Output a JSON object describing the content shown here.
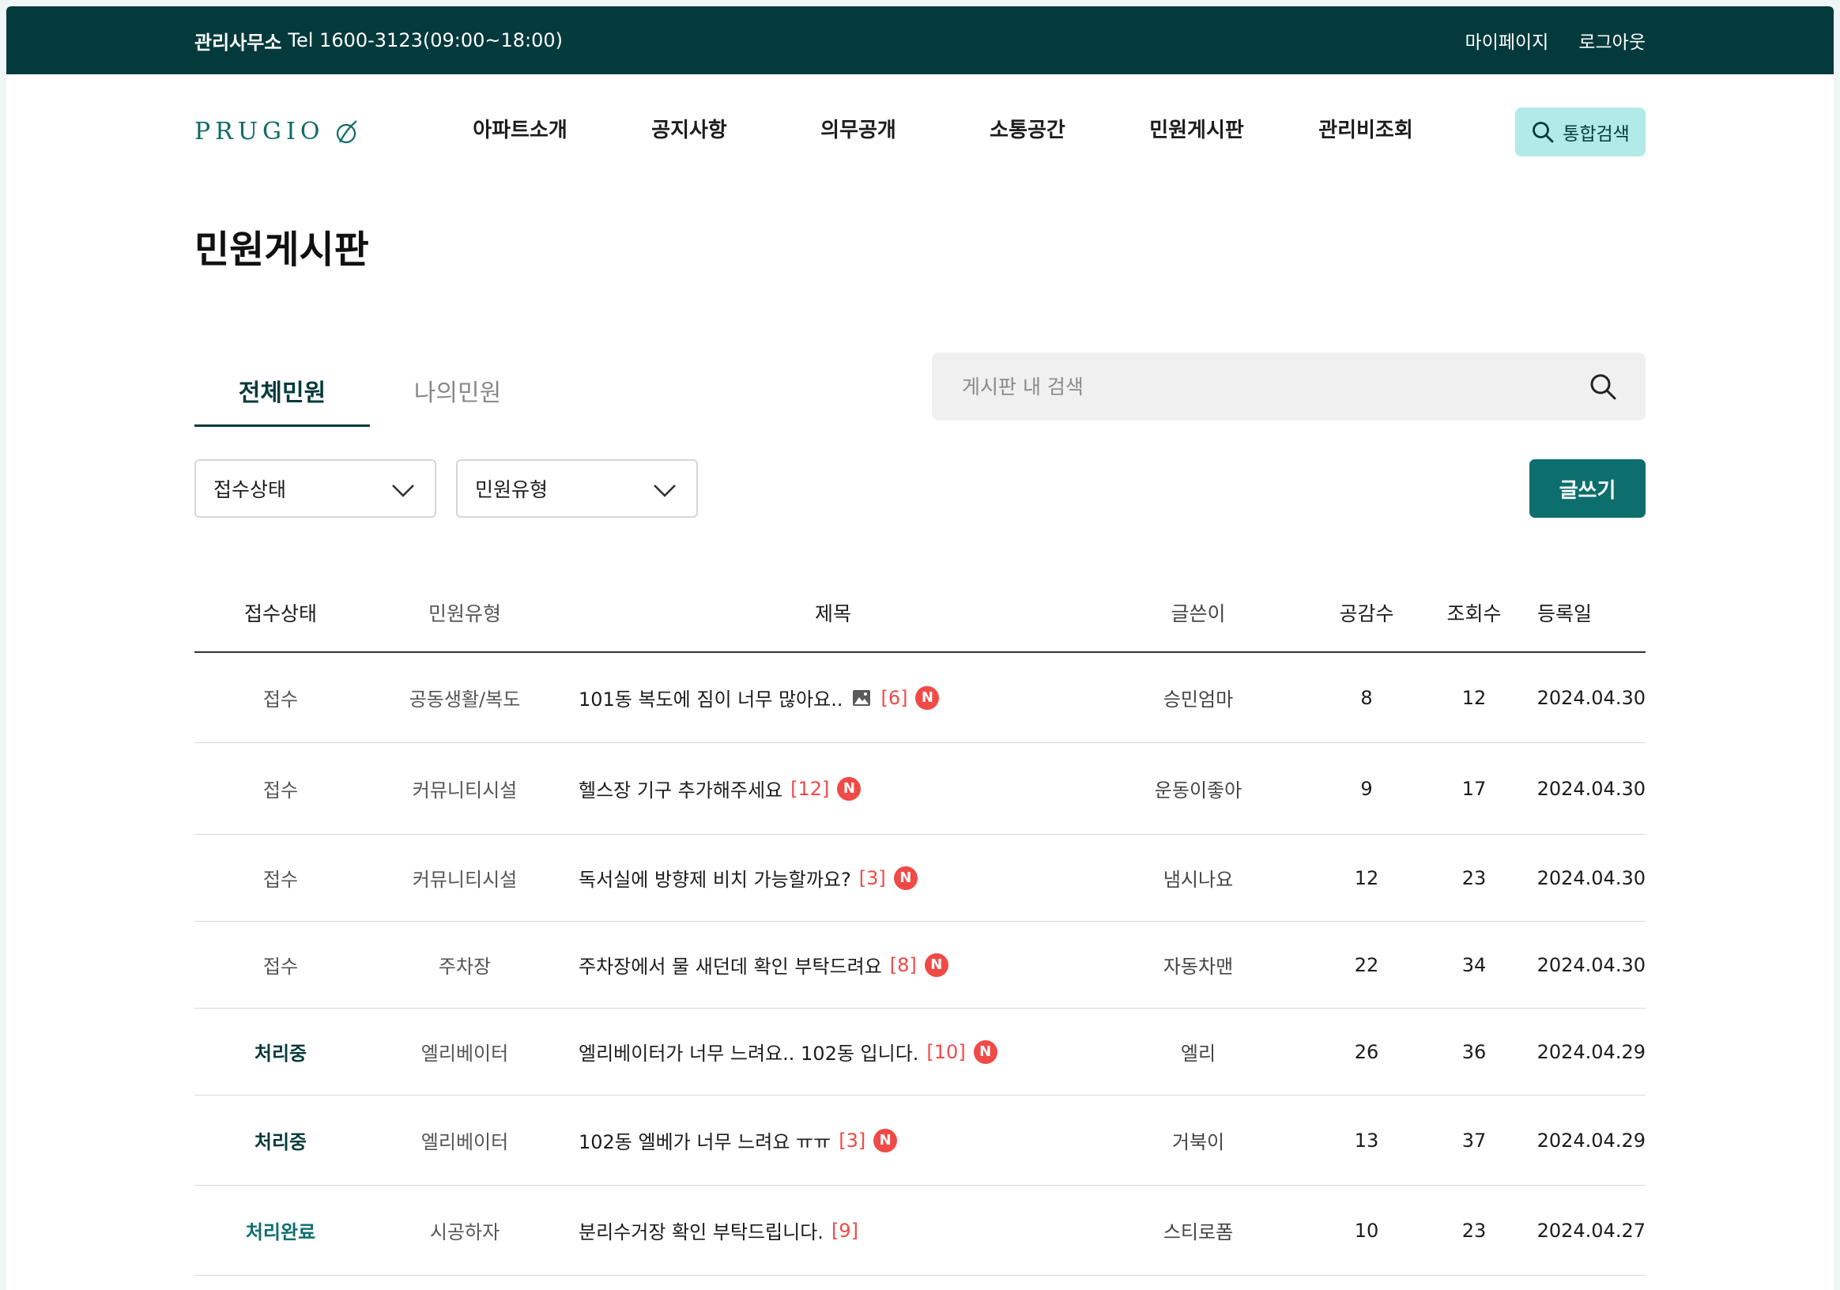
{
  "topbar": {
    "office_label": "관리사무소",
    "office_tel": "Tel 1600-3123(09:00~18:00)",
    "mypage": "마이페이지",
    "logout": "로그아웃"
  },
  "header": {
    "logo_text": "PRUGIO",
    "nav": [
      "아파트소개",
      "공지사항",
      "의무공개",
      "소통공간",
      "민원게시판",
      "관리비조회"
    ],
    "search_all": "통합검색"
  },
  "page_title": "민원게시판",
  "tabs": [
    {
      "label": "전체민원",
      "active": true
    },
    {
      "label": "나의민원",
      "active": false
    }
  ],
  "board_search": {
    "placeholder": "게시판 내 검색"
  },
  "filters": {
    "status": "접수상태",
    "type": "민원유형"
  },
  "write_button": "글쓰기",
  "colors": {
    "topbar": "#053a3c",
    "accent": "#0d6e6e",
    "search_all_bg": "#b2eae9",
    "new_badge": "#f04a47"
  },
  "table": {
    "columns": [
      "접수상태",
      "민원유형",
      "제목",
      "글쓴이",
      "공감수",
      "조회수",
      "등록일"
    ],
    "rows": [
      {
        "status": "접수",
        "status_kind": "recv",
        "type": "공동생활/복도",
        "title": "101동 복도에 짐이 너무 많아요..",
        "has_image": true,
        "comments": "[6]",
        "is_new": true,
        "new_label": "N",
        "author": "승민엄마",
        "likes": "8",
        "views": "12",
        "date": "2024.04.30"
      },
      {
        "status": "접수",
        "status_kind": "recv",
        "type": "커뮤니티시설",
        "title": "헬스장 기구 추가해주세요",
        "has_image": false,
        "comments": "[12]",
        "is_new": true,
        "new_label": "N",
        "author": "운동이좋아",
        "likes": "9",
        "views": "17",
        "date": "2024.04.30"
      },
      {
        "status": "접수",
        "status_kind": "recv",
        "type": "커뮤니티시설",
        "title": "독서실에 방향제 비치 가능할까요?",
        "has_image": false,
        "comments": "[3]",
        "is_new": true,
        "new_label": "N",
        "author": "냄시나요",
        "likes": "12",
        "views": "23",
        "date": "2024.04.30"
      },
      {
        "status": "접수",
        "status_kind": "recv",
        "type": "주차장",
        "title": "주차장에서 물 새던데 확인 부탁드려요",
        "has_image": false,
        "comments": "[8]",
        "is_new": true,
        "new_label": "N",
        "author": "자동차맨",
        "likes": "22",
        "views": "34",
        "date": "2024.04.30"
      },
      {
        "status": "처리중",
        "status_kind": "proc",
        "type": "엘리베이터",
        "title": "엘리베이터가 너무 느려요.. 102동 입니다.",
        "has_image": false,
        "comments": "[10]",
        "is_new": true,
        "new_label": "N",
        "author": "엘리",
        "likes": "26",
        "views": "36",
        "date": "2024.04.29"
      },
      {
        "status": "처리중",
        "status_kind": "proc",
        "type": "엘리베이터",
        "title": "102동 엘베가 너무 느려요 ㅠㅠ",
        "has_image": false,
        "comments": "[3]",
        "is_new": true,
        "new_label": "N",
        "author": "거북이",
        "likes": "13",
        "views": "37",
        "date": "2024.04.29"
      },
      {
        "status": "처리완료",
        "status_kind": "done",
        "type": "시공하자",
        "title": "분리수거장 확인 부탁드립니다.",
        "has_image": false,
        "comments": "[9]",
        "is_new": false,
        "new_label": "N",
        "author": "스티로폼",
        "likes": "10",
        "views": "23",
        "date": "2024.04.27"
      }
    ]
  }
}
